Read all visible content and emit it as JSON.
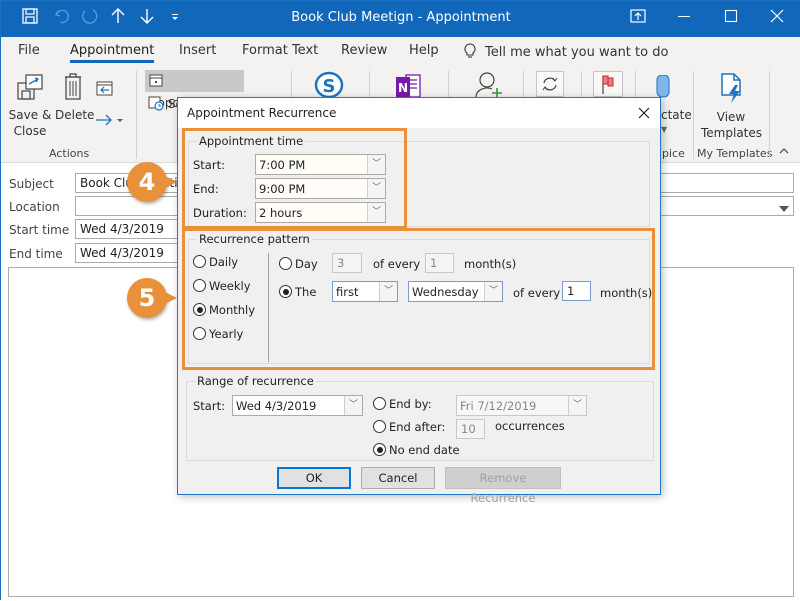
{
  "window": {
    "title": "Book Club Meetign  -  Appointment",
    "quick_access": [
      "save-icon",
      "undo-icon",
      "redo-icon",
      "up-arrow-icon",
      "down-arrow-icon",
      "customize-icon"
    ],
    "controls": {
      "restore_ribbon": "▣",
      "minimize": "—",
      "maximize": "☐",
      "close": "✕"
    }
  },
  "tabs": [
    {
      "label": "File"
    },
    {
      "label": "Appointment",
      "active": true
    },
    {
      "label": "Insert"
    },
    {
      "label": "Format Text"
    },
    {
      "label": "Review"
    },
    {
      "label": "Help"
    }
  ],
  "tell_me": "Tell me what you want to do",
  "ribbon": {
    "save_close": "Save &\nClose",
    "save_label_1": "Save &",
    "save_label_2": "Close",
    "delete": "Delete",
    "actions_group": "Actions",
    "appointment": "Appointment",
    "scheduling_partial": "Sc",
    "dictate_partial": "ctate",
    "voice_group_partial": "pice",
    "view_templates_1": "View",
    "view_templates_2": "Templates",
    "my_templates_group": "My Templates"
  },
  "form": {
    "subject_label": "Subject",
    "subject_value": "Book Club Meetign",
    "location_label": "Location",
    "location_value": "",
    "start_label": "Start time",
    "start_value": "Wed 4/3/2019",
    "end_label": "End time",
    "end_value": "Wed 4/3/2019"
  },
  "dialog": {
    "title": "Appointment Recurrence",
    "appointment_time": {
      "legend": "Appointment time",
      "start_label": "Start:",
      "start_value": "7:00 PM",
      "end_label": "End:",
      "end_value": "9:00 PM",
      "duration_label": "Duration:",
      "duration_value": "2 hours"
    },
    "recurrence_pattern": {
      "legend": "Recurrence pattern",
      "options": [
        {
          "label": "Daily",
          "selected": false
        },
        {
          "label": "Weekly",
          "selected": false
        },
        {
          "label": "Monthly",
          "selected": true
        },
        {
          "label": "Yearly",
          "selected": false
        }
      ],
      "day_option": {
        "label": "Day",
        "selected": false,
        "day_value": "3",
        "of_every": "of every",
        "months_value": "1",
        "unit": "month(s)"
      },
      "the_option": {
        "label": "The",
        "selected": true,
        "ordinal": "first",
        "weekday": "Wednesday",
        "of_every": "of every",
        "months_value": "1",
        "unit": "month(s)"
      }
    },
    "range": {
      "legend": "Range of recurrence",
      "start_label": "Start:",
      "start_value": "Wed 4/3/2019",
      "end_by_label": "End by:",
      "end_by_value": "Fri 7/12/2019",
      "end_by_selected": false,
      "end_after_label": "End after:",
      "end_after_value": "10",
      "end_after_unit": "occurrences",
      "end_after_selected": false,
      "no_end_label": "No end date",
      "no_end_selected": true
    },
    "buttons": {
      "ok": "OK",
      "cancel": "Cancel",
      "remove": "Remove Recurrence"
    }
  },
  "callouts": {
    "step4": "4",
    "step5": "5"
  },
  "colors": {
    "accent": "#1168bb",
    "highlight": "#e8913a"
  }
}
